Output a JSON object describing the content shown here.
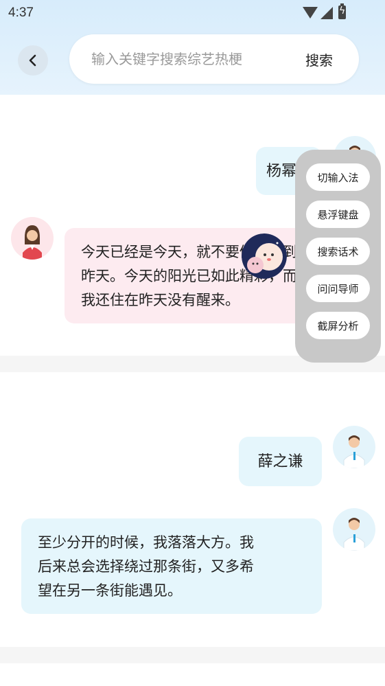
{
  "status_bar": {
    "time": "4:37"
  },
  "header": {
    "search_placeholder": "输入关键字搜索综艺热梗",
    "search_button": "搜索"
  },
  "cards": [
    {
      "name_bubble": "杨幂",
      "quote": "今天已经是今天，就不要做梦回到昨天。今天的阳光已如此精彩，而我还住在昨天没有醒来。",
      "quote_lines": [
        "今天已经是今天，就不要做梦回到",
        "昨天。今天的阳光已如此精彩，而",
        "我还住在昨天没有醒来。"
      ]
    },
    {
      "name_bubble": "薛之谦",
      "quote_lines": [
        "至少分开的时候，我落落大方。我",
        "后来总会选择绕过那条街，又多希",
        "望在另一条街能遇见。"
      ]
    }
  ],
  "float_menu": {
    "items": [
      "切输入法",
      "悬浮键盘",
      "搜索话术",
      "问问导师",
      "截屏分析"
    ]
  },
  "icons": {
    "back": "chevron-left-icon",
    "wifi": "wifi-icon",
    "signal": "signal-icon",
    "battery": "battery-charging-icon"
  },
  "colors": {
    "header_bg": "#d7ecfb",
    "bubble_blue": "#e5f6fc",
    "bubble_pink": "#fdebf0",
    "float_panel": "#c8c8c8"
  }
}
